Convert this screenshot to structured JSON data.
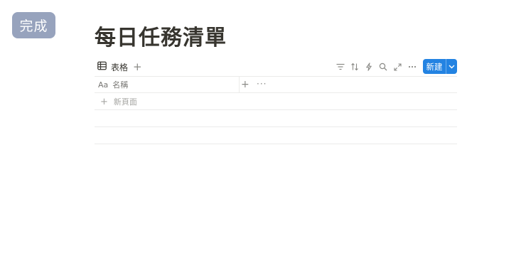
{
  "done_button": {
    "label": "完成"
  },
  "page": {
    "title": "每日任務清單"
  },
  "toolbar": {
    "view_tab": {
      "icon": "table-icon",
      "label": "表格"
    },
    "add_view_icon": "plus-icon",
    "actions": [
      "filter-icon",
      "sort-icon",
      "automation-icon",
      "search-icon",
      "expand-icon",
      "more-icon"
    ],
    "new_button": {
      "label": "新建",
      "dropdown_icon": "chevron-down-icon"
    }
  },
  "table": {
    "columns": [
      {
        "type_icon": "Aa",
        "label": "名稱"
      }
    ],
    "add_column_icon": "plus-icon",
    "more_icon": "more-icon",
    "new_row_label": "新頁面",
    "rows": []
  },
  "colors": {
    "accent": "#2383e2",
    "done_button_bg": "#97a3bd",
    "border": "#ebebea"
  }
}
